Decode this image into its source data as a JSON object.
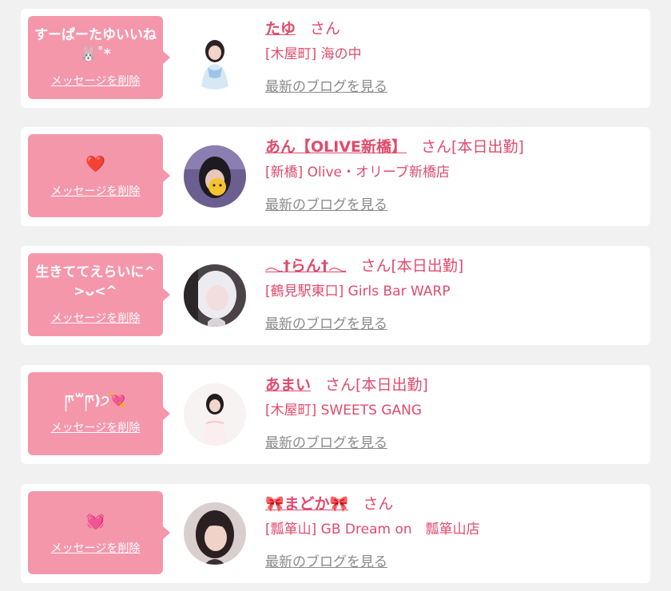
{
  "entries": [
    {
      "message": "すーぱーたゆいいね🐰˚*",
      "delete_label": "メッセージを削除",
      "name": "たゆ",
      "honorific": "さん",
      "status": "",
      "shop": "[木屋町] 海の中",
      "blog_label": "最新のブログを見る"
    },
    {
      "message": "❤️",
      "delete_label": "メッセージを削除",
      "name": "あん【OLIVE新橋】",
      "honorific": "さん",
      "status": "[本日出勤]",
      "shop": "[新橋] Olive・オリーブ新橋店",
      "blog_label": "最新のブログを見る"
    },
    {
      "message": "生きててえらいに^>ᴗ<^",
      "delete_label": "メッセージを削除",
      "name": "𓂃†らん†𓂃",
      "honorific": "さん",
      "status": "[本日出勤]",
      "shop": "[鶴見駅東口] Girls Bar WARP",
      "blog_label": "最新のブログを見る"
    },
    {
      "message": "ཫ꒳ཫ)੭💘",
      "delete_label": "メッセージを削除",
      "name": "あまい",
      "honorific": "さん",
      "status": "[本日出勤]",
      "shop": "[木屋町] SWEETS GANG",
      "blog_label": "最新のブログを見る"
    },
    {
      "message": "💓",
      "delete_label": "メッセージを削除",
      "name": "🎀まどか🎀",
      "honorific": "さん",
      "status": "",
      "shop": "[瓢箪山] GB Dream on　瓢箪山店",
      "blog_label": "最新のブログを見る"
    }
  ],
  "colors": {
    "page_background": "#f1f1f1",
    "card_background": "#ffffff",
    "bubble_pink": "#f597ab",
    "accent_text": "#e04b6c",
    "link_gray": "#8a8a8a"
  }
}
